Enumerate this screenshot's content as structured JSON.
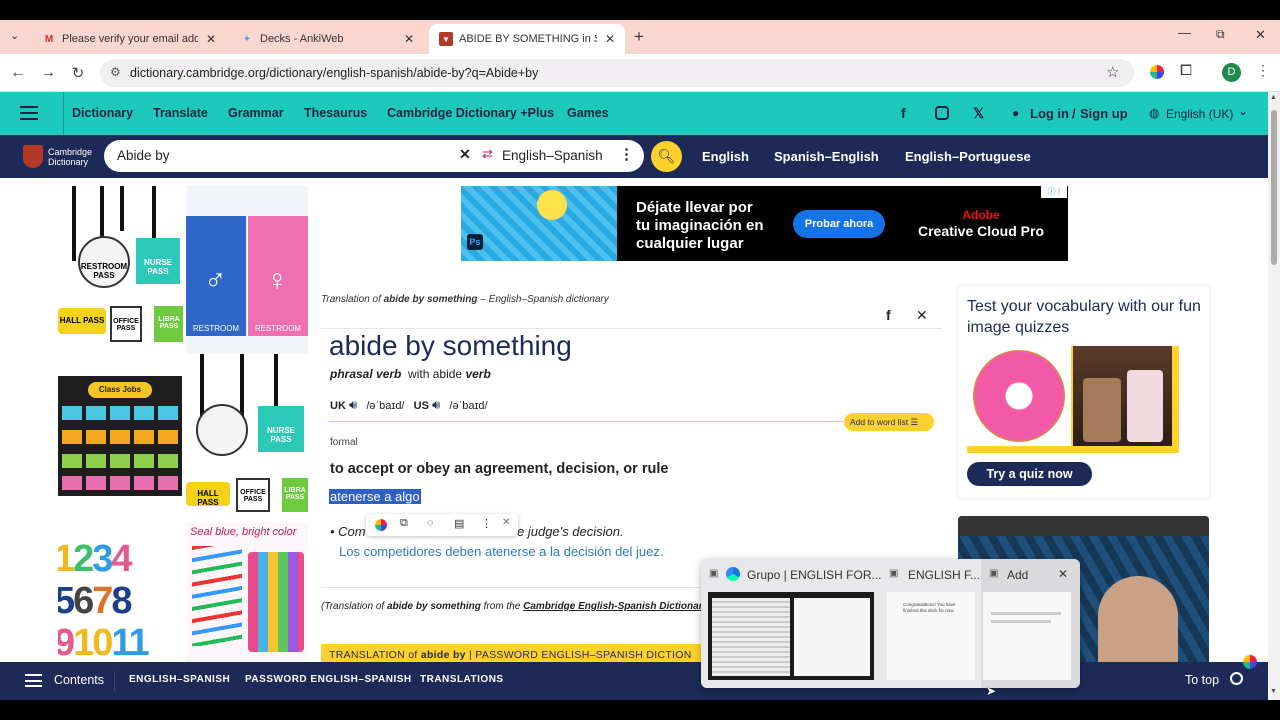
{
  "browser": {
    "tabs": [
      {
        "title": "Please verify your email address",
        "icon": "gmail-icon",
        "active": false
      },
      {
        "title": "Decks - AnkiWeb",
        "icon": "anki-icon",
        "active": false
      },
      {
        "title": "ABIDE BY SOMETHING in Spanish",
        "icon": "cambridge-icon",
        "active": true
      }
    ],
    "url": "dictionary.cambridge.org/dictionary/english-spanish/abide-by?q=Abide+by",
    "profile_initial": "D"
  },
  "site_nav": {
    "items": [
      "Dictionary",
      "Translate",
      "Grammar",
      "Thesaurus",
      "Cambridge Dictionary +Plus",
      "Games"
    ],
    "login": "Log in",
    "signup": "Sign up",
    "login_sep": "/",
    "language": "English (UK)"
  },
  "search_bar": {
    "logo_line1": "Cambridge",
    "logo_line2": "Dictionary",
    "query": "Abide by",
    "dictionary": "English–Spanish",
    "links": [
      "English",
      "Spanish–English",
      "English–Portuguese"
    ]
  },
  "ad": {
    "headline1": "Déjate llevar por",
    "headline2": "tu imaginación en",
    "headline3": "cualquier lugar",
    "button": "Probar ahora",
    "brand1": "Adobe",
    "brand2": "Creative Cloud Pro",
    "ps_label": "Ps"
  },
  "entry": {
    "translation_prefix": "Translation of",
    "translation_word": "abide by something",
    "translation_suffix": "– English–Spanish dictionary",
    "headword": "abide by something",
    "pos": "phrasal verb",
    "with_text": "with",
    "with_word": "abide",
    "with_pos": "verb",
    "uk": "UK",
    "uk_ipa": "/əˈbaɪd/",
    "us": "US",
    "us_ipa": "/əˈbaɪd/",
    "add_to_list": "Add to word list",
    "register": "formal",
    "definition": "to accept or obey an agreement, decision, or rule",
    "translation": "atenerse a algo",
    "example_start": "Com",
    "example_end": "e judge's decision.",
    "example_es": "Los competidores deben atenerse a la decisión del juez.",
    "source_prefix": "(Translation of",
    "source_word": "abide by something",
    "source_mid": "from the",
    "source_link": "Cambridge English-Spanish Dictionar",
    "banner_prefix": "TRANSLATION of",
    "banner_word": "abide by",
    "banner_suffix": "| PASSWORD ENGLISH–SPANISH DICTION"
  },
  "quiz": {
    "title": "Test your vocabulary with our fun image quizzes",
    "button": "Try a quiz now"
  },
  "products": {
    "restroom": "RESTROOM",
    "restroom_pass": "RESTROOM PASS",
    "nurse_pass": "NURSE PASS",
    "office_pass": "OFFICE PASS",
    "hall_pass": "HALL PASS",
    "library_pass": "LIBRA PASS",
    "class_jobs": "Class Jobs",
    "seal_text": "Seal blue, bright color",
    "numbers": [
      "1",
      "2",
      "3",
      "4",
      "5",
      "6",
      "7",
      "8",
      "9",
      "10",
      "11"
    ]
  },
  "bottom_nav": {
    "contents": "Contents",
    "links": [
      "ENGLISH–SPANISH",
      "PASSWORD ENGLISH–SPANISH",
      "TRANSLATIONS"
    ],
    "to_top": "To top"
  },
  "taskbar_popup": {
    "items": [
      {
        "title": "Grupo | ENGLISH FOR..."
      },
      {
        "title": "ENGLISH F..."
      },
      {
        "title": "Add"
      }
    ],
    "thumb_text": "Congratulations! You have finished this deck for now."
  },
  "colors": {
    "teal": "#1dc9bb",
    "navy": "#1d2a57",
    "yellow": "#fed22a",
    "tab_strip": "#f9d7cf"
  }
}
